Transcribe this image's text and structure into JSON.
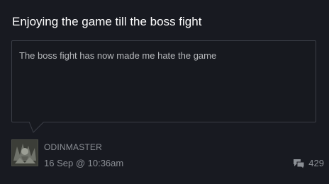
{
  "discussion": {
    "title": "Enjoying the game till the boss fight",
    "body": "The boss fight has now made me hate the game"
  },
  "author": {
    "name": "ODINMASTER",
    "avatar_icon": "user-avatar-image",
    "posted": "16 Sep @ 10:36am"
  },
  "stats": {
    "comment_icon": "speech-bubbles-icon",
    "comment_count": "429"
  },
  "colors": {
    "background": "#181a21",
    "title": "#ffffff",
    "muted_text": "#8b8f95",
    "bubble_border": "#3b3e46"
  }
}
